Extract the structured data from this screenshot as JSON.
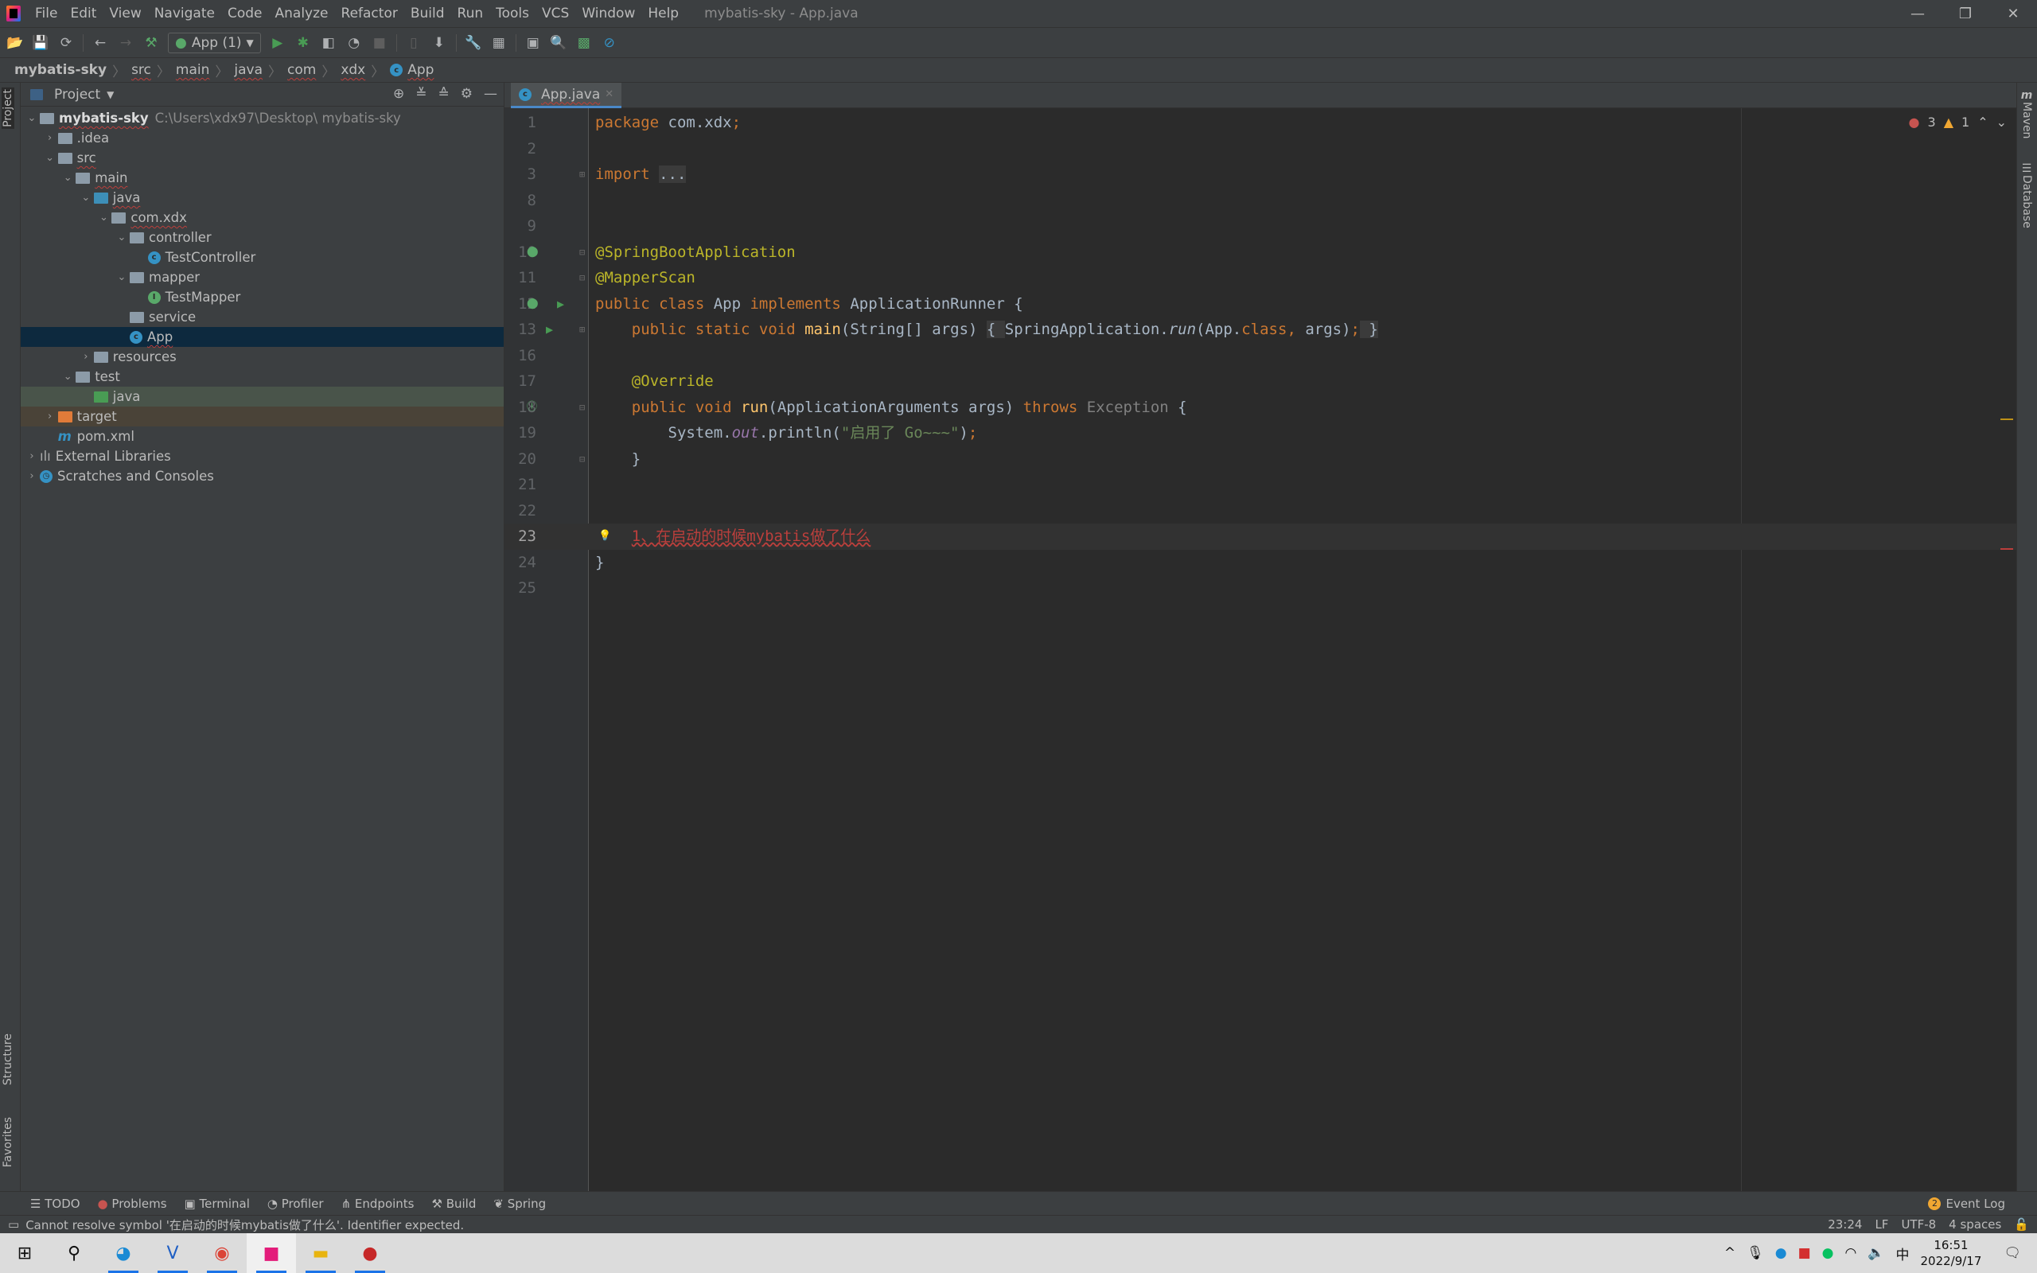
{
  "window": {
    "title": "mybatis-sky - App.java"
  },
  "menu": [
    "File",
    "Edit",
    "View",
    "Navigate",
    "Code",
    "Analyze",
    "Refactor",
    "Build",
    "Run",
    "Tools",
    "VCS",
    "Window",
    "Help"
  ],
  "toolbar": {
    "run_config": "App (1)"
  },
  "breadcrumb": [
    "mybatis-sky",
    "src",
    "main",
    "java",
    "com",
    "xdx",
    "App"
  ],
  "project": {
    "header": "Project",
    "root": {
      "name": "mybatis-sky",
      "path": "C:\\Users\\xdx97\\Desktop\\ mybatis-sky"
    },
    "items": [
      {
        "label": ".idea",
        "level": 1,
        "arrow": "right",
        "icon": "folder"
      },
      {
        "label": "src",
        "level": 1,
        "arrow": "down",
        "icon": "folder"
      },
      {
        "label": "main",
        "level": 2,
        "arrow": "down",
        "icon": "folder"
      },
      {
        "label": "java",
        "level": 3,
        "arrow": "down",
        "icon": "source-folder"
      },
      {
        "label": "com.xdx",
        "level": 4,
        "arrow": "down",
        "icon": "package"
      },
      {
        "label": "controller",
        "level": 5,
        "arrow": "down",
        "icon": "package"
      },
      {
        "label": "TestController",
        "level": 6,
        "arrow": "",
        "icon": "class"
      },
      {
        "label": "mapper",
        "level": 5,
        "arrow": "down",
        "icon": "package"
      },
      {
        "label": "TestMapper",
        "level": 6,
        "arrow": "",
        "icon": "interface"
      },
      {
        "label": "service",
        "level": 5,
        "arrow": "",
        "icon": "package"
      },
      {
        "label": "App",
        "level": 5,
        "arrow": "",
        "icon": "spring-class",
        "selected": true
      },
      {
        "label": "resources",
        "level": 3,
        "arrow": "right",
        "icon": "resources-folder"
      },
      {
        "label": "test",
        "level": 2,
        "arrow": "down",
        "icon": "folder"
      },
      {
        "label": "java",
        "level": 3,
        "arrow": "",
        "icon": "test-folder",
        "test": true
      },
      {
        "label": "target",
        "level": 1,
        "arrow": "right",
        "icon": "excluded-folder",
        "excluded": true
      },
      {
        "label": "pom.xml",
        "level": 1,
        "arrow": "",
        "icon": "maven"
      },
      {
        "label": "External Libraries",
        "level": 0,
        "arrow": "right",
        "icon": "libraries"
      },
      {
        "label": "Scratches and Consoles",
        "level": 0,
        "arrow": "right",
        "icon": "scratches"
      }
    ]
  },
  "left_stripe": {
    "project": "Project",
    "structure": "Structure",
    "favorites": "Favorites"
  },
  "right_stripe": {
    "maven": "Maven",
    "database": "Database"
  },
  "editor": {
    "tab": "App.java",
    "errors": "3",
    "warnings": "1",
    "lines": [
      {
        "n": "1",
        "tokens": [
          [
            "kw",
            "package "
          ],
          [
            "tx",
            "com.xdx"
          ],
          [
            "kw",
            ";"
          ]
        ]
      },
      {
        "n": "2",
        "tokens": []
      },
      {
        "n": "3",
        "tokens": [
          [
            "kw",
            "import "
          ],
          [
            "fold",
            "..."
          ]
        ]
      },
      {
        "n": "8",
        "tokens": []
      },
      {
        "n": "9",
        "tokens": []
      },
      {
        "n": "10",
        "tokens": [
          [
            "an",
            "@SpringBootApplication"
          ]
        ]
      },
      {
        "n": "11",
        "tokens": [
          [
            "an",
            "@MapperScan"
          ]
        ]
      },
      {
        "n": "12",
        "tokens": [
          [
            "kw",
            "public class "
          ],
          [
            "tx",
            "App "
          ],
          [
            "kw",
            "implements "
          ],
          [
            "tx",
            "ApplicationRunner {"
          ]
        ]
      },
      {
        "n": "13",
        "tokens": [
          [
            "tx",
            "    "
          ],
          [
            "kw",
            "public static void "
          ],
          [
            "fn",
            "main"
          ],
          [
            "tx",
            "(String[] args) "
          ],
          [
            "fold",
            "{ "
          ],
          [
            "tx",
            "SpringApplication."
          ],
          [
            "itf",
            "run"
          ],
          [
            "tx",
            "(App."
          ],
          [
            "kw",
            "class"
          ],
          [
            "kw",
            ", "
          ],
          [
            "tx",
            "args)"
          ],
          [
            "kw",
            ";"
          ],
          [
            "fold",
            " }"
          ]
        ]
      },
      {
        "n": "16",
        "tokens": []
      },
      {
        "n": "17",
        "tokens": [
          [
            "tx",
            "    "
          ],
          [
            "an",
            "@Override"
          ]
        ]
      },
      {
        "n": "18",
        "tokens": [
          [
            "tx",
            "    "
          ],
          [
            "kw",
            "public void "
          ],
          [
            "fn",
            "run"
          ],
          [
            "tx",
            "(ApplicationArguments args) "
          ],
          [
            "kw",
            "throws "
          ],
          [
            "gr",
            "Exception "
          ],
          [
            "tx",
            "{"
          ]
        ]
      },
      {
        "n": "19",
        "tokens": [
          [
            "tx",
            "        System."
          ],
          [
            "it",
            "out"
          ],
          [
            "tx",
            ".println("
          ],
          [
            "st",
            "\"启用了 Go~~~\""
          ],
          [
            "tx",
            ")"
          ],
          [
            "kw",
            ";"
          ]
        ]
      },
      {
        "n": "20",
        "tokens": [
          [
            "tx",
            "    }"
          ]
        ]
      },
      {
        "n": "21",
        "tokens": []
      },
      {
        "n": "22",
        "tokens": []
      },
      {
        "n": "23",
        "tokens": [
          [
            "tx",
            "    "
          ],
          [
            "err",
            "1、在启动的时候mybatis做了什么"
          ]
        ],
        "current": true
      },
      {
        "n": "24",
        "tokens": [
          [
            "tx",
            "}"
          ]
        ]
      },
      {
        "n": "25",
        "tokens": []
      }
    ]
  },
  "bottom_tools": [
    "TODO",
    "Problems",
    "Terminal",
    "Profiler",
    "Endpoints",
    "Build",
    "Spring"
  ],
  "event_log": {
    "label": "Event Log",
    "count": "2"
  },
  "status": {
    "message": "Cannot resolve symbol '在启动的时候mybatis做了什么'. Identifier expected.",
    "position": "23:24",
    "line_sep": "LF",
    "encoding": "UTF-8",
    "indent": "4 spaces"
  },
  "taskbar": {
    "time": "16:51",
    "date": "2022/9/17",
    "ime": "中"
  },
  "colors": {
    "keyword": "#cc7832",
    "annotation": "#bbb529",
    "string": "#6a8759",
    "method": "#ffc66d",
    "error": "#bc3f3c",
    "selection": "#0d293e"
  }
}
